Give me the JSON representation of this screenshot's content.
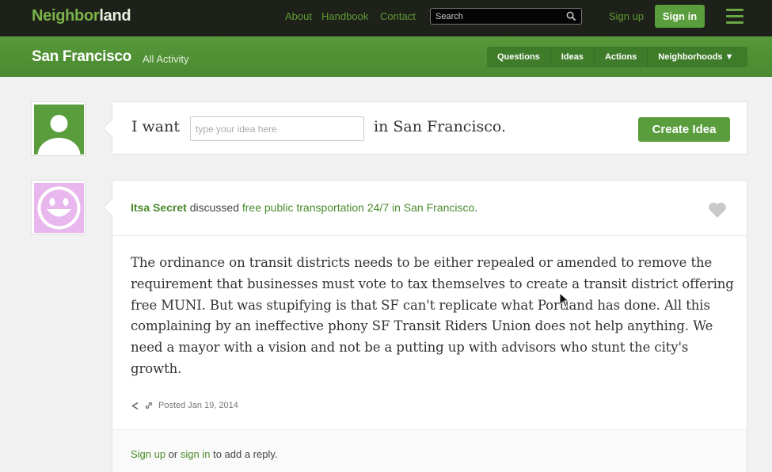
{
  "topbar": {
    "logo_part1": "Neighbor",
    "logo_part2": "land",
    "links": [
      "About",
      "Handbook",
      "Contact"
    ],
    "search_placeholder": "Search",
    "signup_label": "Sign up",
    "signin_label": "Sign in"
  },
  "subbar": {
    "city": "San Francisco",
    "all_activity": "All Activity",
    "nav": [
      "Questions",
      "Ideas",
      "Actions",
      "Neighborhoods ▼"
    ]
  },
  "idea_form": {
    "prefix": "I want",
    "placeholder": "type your idea here",
    "suffix": "in San Francisco.",
    "button": "Create Idea"
  },
  "post": {
    "author": "Itsa Secret",
    "verb": "discussed",
    "topic": "free public transportation 24/7 in San Francisco",
    "topic_end": ".",
    "body": "The ordinance on transit districts needs to be either repealed or amended to remove the requirement that businesses must vote to tax themselves to create a transit district offering free MUNI. But was stupifying is that SF can't replicate what Portland has done. All this complaining by an ineffective phony SF Transit Riders Union does not help anything. We need a mayor with a vision and not be a putting up with advisors who stunt the city's growth.",
    "posted": "Posted Jan 19, 2014"
  },
  "reply": {
    "signup": "Sign up",
    "or": " or ",
    "signin": "sign in",
    "suffix": " to add a reply."
  },
  "colors": {
    "brand_green": "#5a9d3c",
    "topbar_bg": "#1e2119",
    "avatar_pink": "#e8b7ee"
  }
}
